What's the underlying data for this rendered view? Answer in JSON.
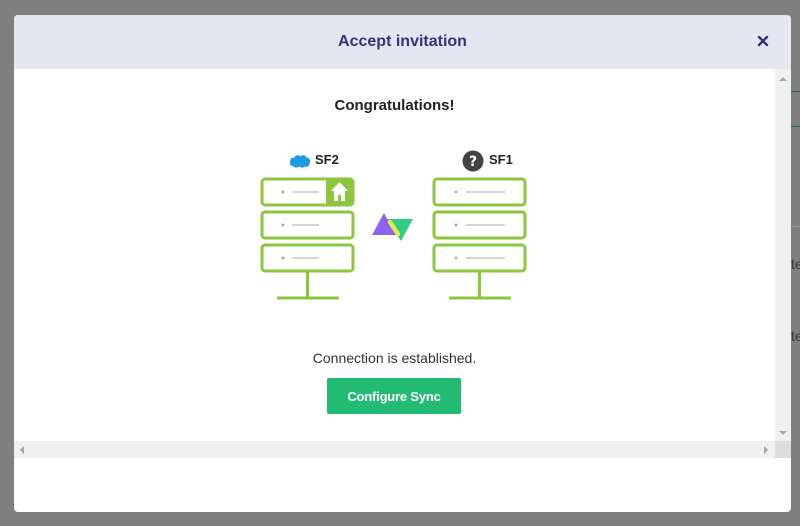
{
  "modal": {
    "title": "Accept invitation",
    "close_icon": "close-icon"
  },
  "content": {
    "heading": "Congratulations!",
    "source": {
      "name": "SF2",
      "icon": "salesforce-cloud-icon"
    },
    "target": {
      "name": "SF1",
      "icon": "question-icon"
    },
    "status_text": "Connection is established.",
    "configure_button": "Configure Sync"
  },
  "background": {
    "partial_text_1": "te",
    "partial_text_2": "te"
  },
  "colors": {
    "server_green": "#8cc63f",
    "button_green": "#22bb73",
    "title_purple": "#3b2f80",
    "header_bg": "#e6e6f0",
    "logo_purple": "#8b63f0",
    "logo_green": "#2ecc85",
    "salesforce_blue": "#1e9be0"
  }
}
